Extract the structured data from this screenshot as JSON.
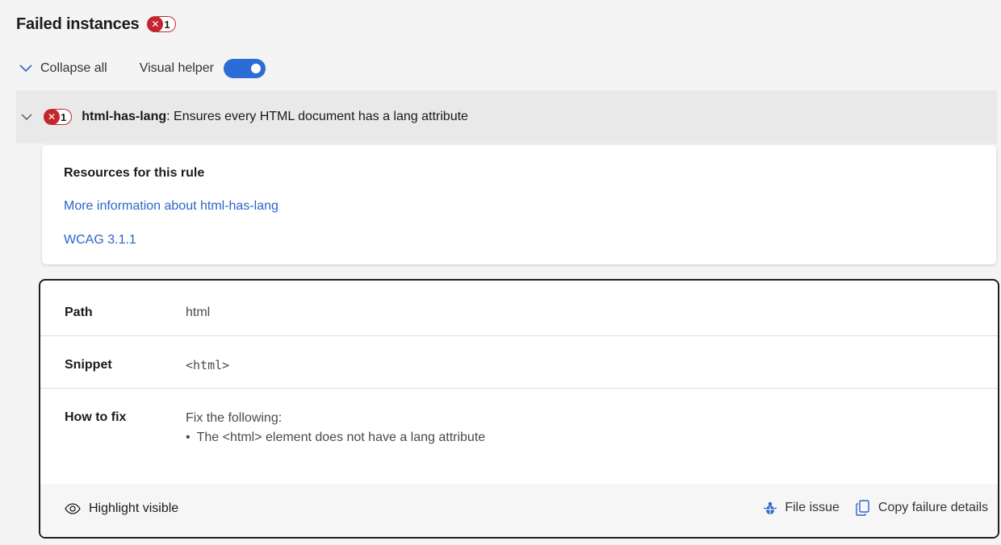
{
  "header": {
    "title": "Failed instances",
    "count": "1",
    "badge_x": "✕"
  },
  "toolbar": {
    "collapse_label": "Collapse all",
    "visual_helper_label": "Visual helper",
    "visual_helper_on": true
  },
  "rule": {
    "count": "1",
    "badge_x": "✕",
    "id": "html-has-lang",
    "description": ": Ensures every HTML document has a lang attribute"
  },
  "resources": {
    "heading": "Resources for this rule",
    "links": [
      "More information about html-has-lang",
      "WCAG 3.1.1"
    ]
  },
  "instance": {
    "path_label": "Path",
    "path_value": "html",
    "snippet_label": "Snippet",
    "snippet_value": "<html>",
    "fix_label": "How to fix",
    "fix_intro": "Fix the following:",
    "fix_items": [
      "The <html> element does not have a lang attribute"
    ]
  },
  "footer": {
    "highlight_label": "Highlight visible",
    "file_issue_label": "File issue",
    "copy_label": "Copy failure details"
  },
  "colors": {
    "error": "#c4262e",
    "link": "#2b64c9",
    "toggle": "#2b6cd6"
  }
}
